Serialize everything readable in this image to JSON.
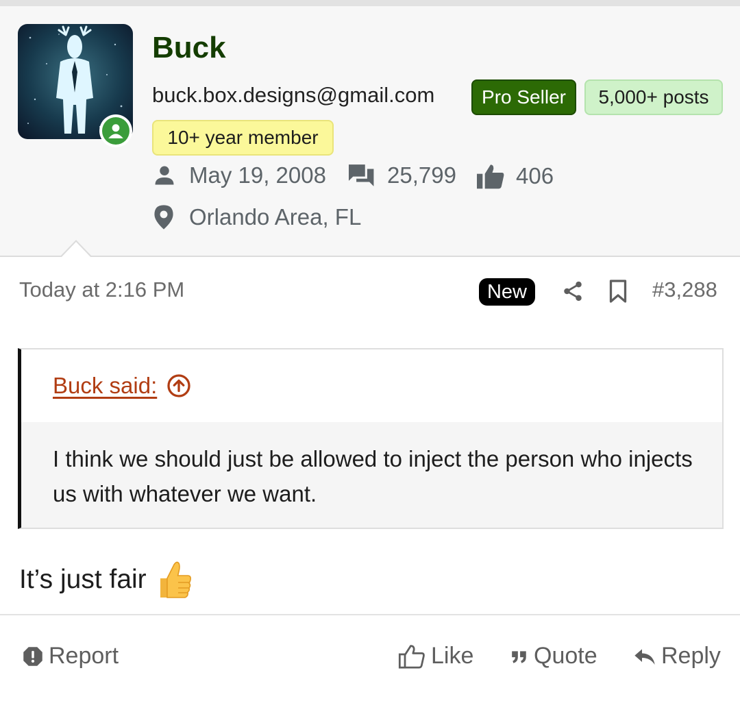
{
  "user": {
    "name": "Buck",
    "email": "buck.box.designs@gmail.com",
    "badges": {
      "pro": "Pro Seller",
      "posts": "5,000+ posts",
      "member": "10+ year member"
    },
    "joined": "May 19, 2008",
    "message_count": "25,799",
    "reaction_score": "406",
    "location": "Orlando Area, FL",
    "status": "online",
    "colors": {
      "name": "#143d00",
      "pro_badge": "#2c6a05",
      "posts_badge": "#cff2c9",
      "member_badge": "#fbf89a",
      "online": "#3b9d3b"
    }
  },
  "post": {
    "time": "Today at 2:16 PM",
    "new_label": "New",
    "number": "#3,288",
    "quote": {
      "author": "Buck said:",
      "text": "I think we should just be allowed to inject the person who injects us with whatever we want."
    },
    "body": "It’s just fair",
    "emoji": "thumbs-up-emoji"
  },
  "actions": {
    "report": "Report",
    "like": "Like",
    "quote": "Quote",
    "reply": "Reply"
  },
  "icons": [
    "user-icon",
    "messages-icon",
    "thumbs-up-icon",
    "location-pin-icon",
    "share-icon",
    "bookmark-icon",
    "arrow-up-circle-icon",
    "alert-icon",
    "like-icon",
    "quote-icon",
    "reply-icon"
  ]
}
